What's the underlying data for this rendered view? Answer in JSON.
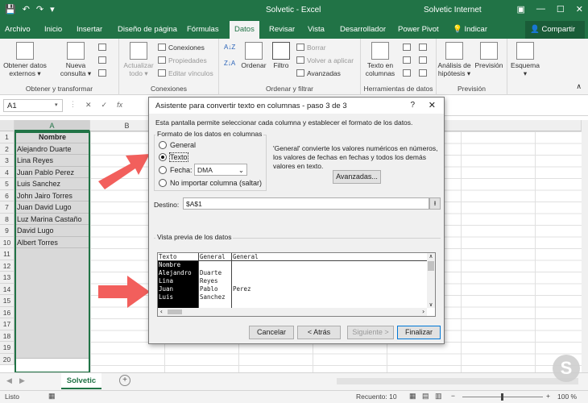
{
  "window": {
    "title": "Solvetic  -  Excel",
    "account": "Solvetic Internet"
  },
  "tabs": [
    "Archivo",
    "Inicio",
    "Insertar",
    "Diseño de página",
    "Fórmulas",
    "Datos",
    "Revisar",
    "Vista",
    "Desarrollador",
    "Power Pivot",
    "Indicar"
  ],
  "share_label": "Compartir",
  "ribbon": {
    "obtener_datos": "Obtener datos externos",
    "nueva_consulta": "Nueva consulta",
    "group1": "Obtener y transformar",
    "actualizar": "Actualizar todo",
    "conexiones_btn": "Conexiones",
    "propiedades": "Propiedades",
    "editar_vinculos": "Editar vínculos",
    "group2": "Conexiones",
    "ordenar": "Ordenar",
    "filtro": "Filtro",
    "borrar": "Borrar",
    "volver": "Volver a aplicar",
    "avanzadas": "Avanzadas",
    "group3": "Ordenar y filtrar",
    "texto_columnas": "Texto en columnas",
    "group4": "Herramientas de datos",
    "analisis": "Análisis de hipótesis",
    "prevision": "Previsión",
    "group5": "Previsión",
    "esquema": "Esquema"
  },
  "formula_bar": {
    "name_box": "A1",
    "fx": "fx"
  },
  "columns": [
    "A",
    "B"
  ],
  "rows": [
    "1",
    "2",
    "3",
    "4",
    "5",
    "6",
    "7",
    "8",
    "9",
    "10",
    "11",
    "12",
    "13",
    "14",
    "15",
    "16",
    "17",
    "18",
    "19",
    "20"
  ],
  "cells": [
    "Nombre",
    "Alejandro Duarte",
    "Lina Reyes",
    "Juan Pablo Perez",
    "Luis Sanchez",
    "John Jairo Torres",
    "Juan David Lugo",
    "Luz Marina Castaño",
    "David Lugo",
    "Albert Torres"
  ],
  "sheet_tab": "Solvetic",
  "status": {
    "ready": "Listo",
    "count": "Recuento: 10",
    "zoom": "100 %"
  },
  "dialog": {
    "title": "Asistente para convertir texto en columnas - paso 3 de 3",
    "help": "?",
    "intro": "Esta pantalla permite seleccionar cada columna y establecer el formato de los datos.",
    "format_legend": "Formato de los datos en columnas",
    "opt_general": "General",
    "opt_texto": "Texto",
    "opt_fecha": "Fecha:",
    "date_value": "DMA",
    "opt_no_importar": "No importar columna (saltar)",
    "description": "'General' convierte los valores numéricos en números, los valores de fechas en fechas y todos los demás valores en texto.",
    "advanced_btn": "Avanzadas...",
    "destino_label": "Destino:",
    "destino_value": "$A$1",
    "preview_legend": "Vista previa de los datos",
    "preview_headers": [
      "Texto",
      "General",
      "General"
    ],
    "preview_col1": [
      "Nombre",
      "Alejandro",
      "Lina",
      "Juan",
      "Luis"
    ],
    "preview_col2": [
      "",
      "Duarte",
      "Reyes",
      "Pablo",
      "Sanchez"
    ],
    "preview_col3": [
      "",
      "",
      "",
      "Perez",
      ""
    ],
    "btn_cancel": "Cancelar",
    "btn_back": "< Atrás",
    "btn_next": "Siguiente >",
    "btn_finish": "Finalizar"
  },
  "colors": {
    "excel_green": "#217346",
    "arrow": "#f25f5c"
  }
}
